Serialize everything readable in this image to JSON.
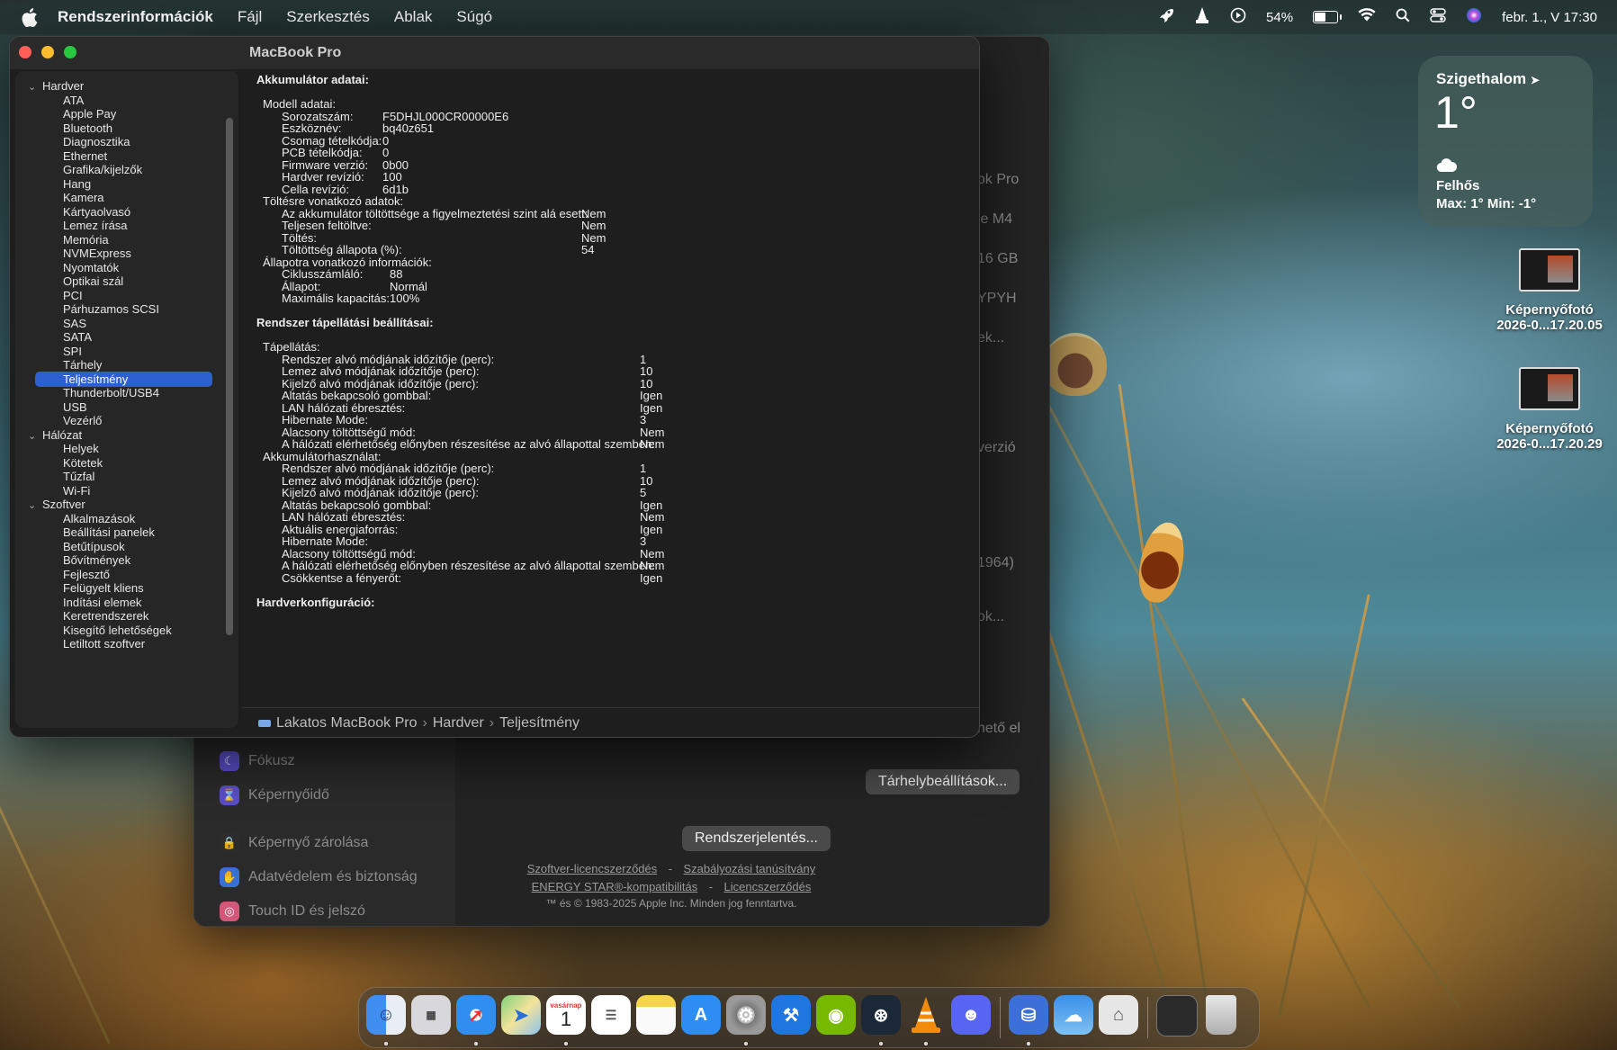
{
  "menubar": {
    "app_name": "Rendszerinformációk",
    "menus": [
      "Fájl",
      "Szerkesztés",
      "Ablak",
      "Súgó"
    ],
    "battery_percent": "54%",
    "battery_level": 0.54,
    "datetime": "febr. 1., V  17:30"
  },
  "window": {
    "title": "MacBook Pro",
    "sidebar": {
      "hardware_label": "Hardver",
      "hardware_items": [
        "ATA",
        "Apple Pay",
        "Bluetooth",
        "Diagnosztika",
        "Ethernet",
        "Grafika/kijelzők",
        "Hang",
        "Kamera",
        "Kártyaolvasó",
        "Lemez írása",
        "Memória",
        "NVMExpress",
        "Nyomtatók",
        "Optikai szál",
        "PCI",
        "Párhuzamos SCSI",
        "SAS",
        "SATA",
        "SPI",
        "Tárhely",
        "Teljesítmény",
        "Thunderbolt/USB4",
        "USB",
        "Vezérlő"
      ],
      "selected_item": "Teljesítmény",
      "network_label": "Hálózat",
      "network_items": [
        "Helyek",
        "Kötetek",
        "Tűzfal",
        "Wi-Fi"
      ],
      "software_label": "Szoftver",
      "software_items": [
        "Alkalmazások",
        "Beállítási panelek",
        "Betűtípusok",
        "Bővítmények",
        "Fejlesztő",
        "Felügyelt kliens",
        "Indítási elemek",
        "Keretrendszerek",
        "Kisegítő lehetőségek",
        "Letiltott szoftver"
      ]
    },
    "content": {
      "battery_heading": "Akkumulátor adatai:",
      "model_heading": "Modell adatai:",
      "model_rows": [
        [
          "Sorozatszám:",
          "F5DHJL000CR00000E6"
        ],
        [
          "Eszköznév:",
          "bq40z651"
        ],
        [
          "Csomag tételkódja:",
          "0"
        ],
        [
          "PCB tételkódja:",
          "0"
        ],
        [
          "Firmware verzió:",
          "0b00"
        ],
        [
          "Hardver revízió:",
          "100"
        ],
        [
          "Cella revízió:",
          "6d1b"
        ]
      ],
      "charge_heading": "Töltésre vonatkozó adatok:",
      "charge_rows": [
        [
          "Az akkumulátor töltöttsége a figyelmeztetési szint alá esett:",
          "Nem"
        ],
        [
          "Teljesen feltöltve:",
          "Nem"
        ],
        [
          "Töltés:",
          "Nem"
        ],
        [
          "Töltöttség állapota (%):",
          "54"
        ]
      ],
      "health_heading": "Állapotra vonatkozó információk:",
      "health_rows": [
        [
          "Ciklusszámláló:",
          "88"
        ],
        [
          "Állapot:",
          "Normál"
        ],
        [
          "Maximális kapacitás:",
          "100%"
        ]
      ],
      "power_heading": "Rendszer tápellátási beállításai:",
      "ac_heading": "Tápellátás:",
      "ac_rows": [
        [
          "Rendszer alvó módjának időzítője (perc):",
          "1"
        ],
        [
          "Lemez alvó módjának időzítője (perc):",
          "10"
        ],
        [
          "Kijelző alvó módjának időzítője (perc):",
          "10"
        ],
        [
          "Altatás bekapcsoló gombbal:",
          "Igen"
        ],
        [
          "LAN hálózati ébresztés:",
          "Igen"
        ],
        [
          "Hibernate Mode:",
          "3"
        ],
        [
          "Alacsony töltöttségű mód:",
          "Nem"
        ],
        [
          "A hálózati elérhetőség előnyben részesítése az alvó állapottal szemben:",
          "Nem"
        ]
      ],
      "batt_heading": "Akkumulátorhasználat:",
      "batt_rows": [
        [
          "Rendszer alvó módjának időzítője (perc):",
          "1"
        ],
        [
          "Lemez alvó módjának időzítője (perc):",
          "10"
        ],
        [
          "Kijelző alvó módjának időzítője (perc):",
          "5"
        ],
        [
          "Altatás bekapcsoló gombbal:",
          "Igen"
        ],
        [
          "LAN hálózati ébresztés:",
          "Nem"
        ],
        [
          "Aktuális energiaforrás:",
          "Igen"
        ],
        [
          "Hibernate Mode:",
          "3"
        ],
        [
          "Alacsony töltöttségű mód:",
          "Nem"
        ],
        [
          "A hálózati elérhetőség előnyben részesítése az alvó állapottal szemben:",
          "Nem"
        ],
        [
          "Csökkentse a fényerőt:",
          "Igen"
        ]
      ],
      "hw_config_heading": "Hardverkonfiguráció:"
    },
    "pathbar": {
      "computer": "Lakatos MacBook Pro",
      "section": "Hardver",
      "item": "Teljesítmény"
    }
  },
  "settings_bg": {
    "peek_labels": [
      "ok Pro",
      "le M4",
      "16 GB",
      "YPYH",
      "ek...",
      "verzió",
      "1964)",
      "ok...",
      "hető el"
    ],
    "sidebar_items": [
      "Fókusz",
      "Képernyőidő",
      "Képernyő zárolása",
      "Adatvédelem és biztonság",
      "Touch ID és jelszó"
    ],
    "storage_button": "Tárhelybeállítások...",
    "report_button": "Rendszerjelentés...",
    "link_software_license": "Szoftver-licencszerződés",
    "link_regulatory": "Szabályozási tanúsítvány",
    "link_energy_star": "ENERGY STAR®-kompatibilitás",
    "link_license": "Licencszerződés",
    "dash": "-",
    "copyright": "™ és © 1983-2025 Apple Inc. Minden jog fenntartva."
  },
  "weather": {
    "city": "Szigethalom",
    "temp": "1°",
    "condition": "Felhős",
    "minmax": "Max: 1° Min: -1°"
  },
  "desktop_files": [
    {
      "name": "Képernyőfotó",
      "sub": "2026-0...17.20.05"
    },
    {
      "name": "Képernyőfotó",
      "sub": "2026-0...17.20.29"
    }
  ],
  "dock": {
    "calendar_month": "vasárnap",
    "calendar_day": "1",
    "apps": [
      "finder-icon",
      "launchpad-icon",
      "safari-icon",
      "maps-icon",
      "calendar-icon",
      "reminders-icon",
      "notes-icon",
      "app-store-icon",
      "system-settings-icon",
      "xcode-icon",
      "nvidia-icon",
      "steam-icon",
      "vlc-icon",
      "discord-icon",
      "disk-utility-icon",
      "weather-icon",
      "homebrew-icon",
      "screenshot-folder-icon",
      "trash-icon"
    ]
  }
}
